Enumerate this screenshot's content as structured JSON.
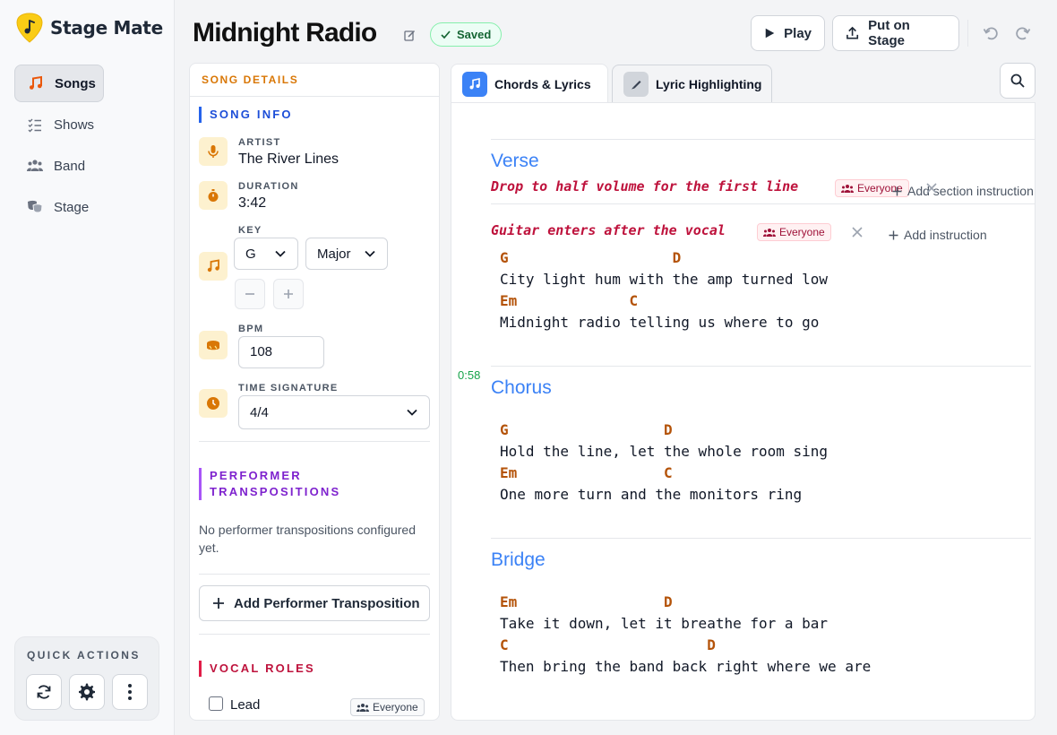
{
  "app": {
    "name": "Stage Mate"
  },
  "sidebar": {
    "items": [
      {
        "label": "Songs"
      },
      {
        "label": "Shows"
      },
      {
        "label": "Band"
      },
      {
        "label": "Stage"
      }
    ],
    "quick_actions_title": "QUICK ACTIONS"
  },
  "header": {
    "title": "Midnight Radio",
    "saved_label": "Saved",
    "play_label": "Play",
    "stage_label": "Put on Stage"
  },
  "details": {
    "heading": "SONG DETAILS",
    "song_info_title": "SONG INFO",
    "artist_label": "ARTIST",
    "artist": "The River Lines",
    "duration_label": "DURATION",
    "duration": "3:42",
    "key_label": "KEY",
    "key_root": "G",
    "key_mode": "Major",
    "bpm_label": "BPM",
    "bpm": "108",
    "time_sig_label": "TIME SIGNATURE",
    "time_sig": "4/4",
    "performer_title_1": "PERFORMER",
    "performer_title_2": "TRANSPOSITIONS",
    "performer_empty_1": "No performer transpositions configured",
    "performer_empty_2": "yet.",
    "add_performer_label": "Add Performer Transposition",
    "vocal_roles_title": "VOCAL ROLES",
    "vocal_role": "Lead",
    "everyone": "Everyone"
  },
  "tabs": [
    {
      "label": "Chords & Lyrics"
    },
    {
      "label": "Lyric Highlighting"
    }
  ],
  "editor": {
    "everyone": "Everyone",
    "add_section_instruction": "Add section instruction",
    "add_instruction": "Add instruction",
    "sections": [
      {
        "name": "Verse",
        "section_instruction": "Drop to half volume for the first line",
        "line_instruction": "Guitar enters after the vocal",
        "lines": [
          {
            "chords": "G                   D",
            "lyric": "City light hum with the amp turned low"
          },
          {
            "chords": "Em             C",
            "lyric": "Midnight radio telling us where to go"
          }
        ]
      },
      {
        "name": "Chorus",
        "timestamp": "0:58",
        "lines": [
          {
            "chords": "G                  D",
            "lyric": "Hold the line, let the whole room sing"
          },
          {
            "chords": "Em                 C",
            "lyric": "One more turn and the monitors ring"
          }
        ]
      },
      {
        "name": "Bridge",
        "lines": [
          {
            "chords": "Em                 D",
            "lyric": "Take it down, let it breathe for a bar"
          },
          {
            "chords": "C                       D",
            "lyric": "Then bring the band back right where we are"
          }
        ]
      }
    ]
  },
  "colors": {
    "accent": "#d97706",
    "section_blue": "#3b82f6",
    "instruction": "#be123c",
    "chord": "#b45309",
    "timestamp": "#16a34a"
  }
}
